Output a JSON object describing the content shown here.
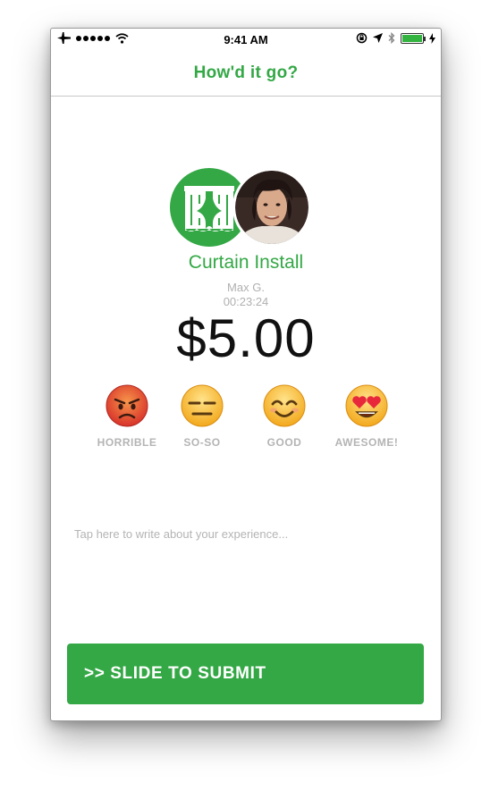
{
  "status_bar": {
    "time": "9:41 AM",
    "icons": [
      "airplane-icon",
      "signal-dots-icon",
      "wifi-icon",
      "rotation-lock-icon",
      "location-arrow-icon",
      "bluetooth-icon",
      "battery-icon",
      "charging-bolt-icon"
    ],
    "battery_level": 1.0
  },
  "header": {
    "title": "How'd it go?"
  },
  "job": {
    "service_name": "Curtain Install",
    "provider_name": "Max G.",
    "duration": "00:23:24",
    "price": "$5.00",
    "service_icon": "curtains-icon"
  },
  "ratings": [
    {
      "label": "HORRIBLE",
      "icon": "angry-face-icon"
    },
    {
      "label": "SO-SO",
      "icon": "expressionless-face-icon"
    },
    {
      "label": "GOOD",
      "icon": "smiling-face-icon"
    },
    {
      "label": "AWESOME!",
      "icon": "heart-eyes-face-icon"
    }
  ],
  "comment": {
    "placeholder": "Tap here to write about your experience...",
    "value": ""
  },
  "submit": {
    "label": ">> SLIDE TO SUBMIT"
  },
  "colors": {
    "accent": "#33a845",
    "muted_text": "#b4b4b4",
    "price_text": "#111111"
  }
}
